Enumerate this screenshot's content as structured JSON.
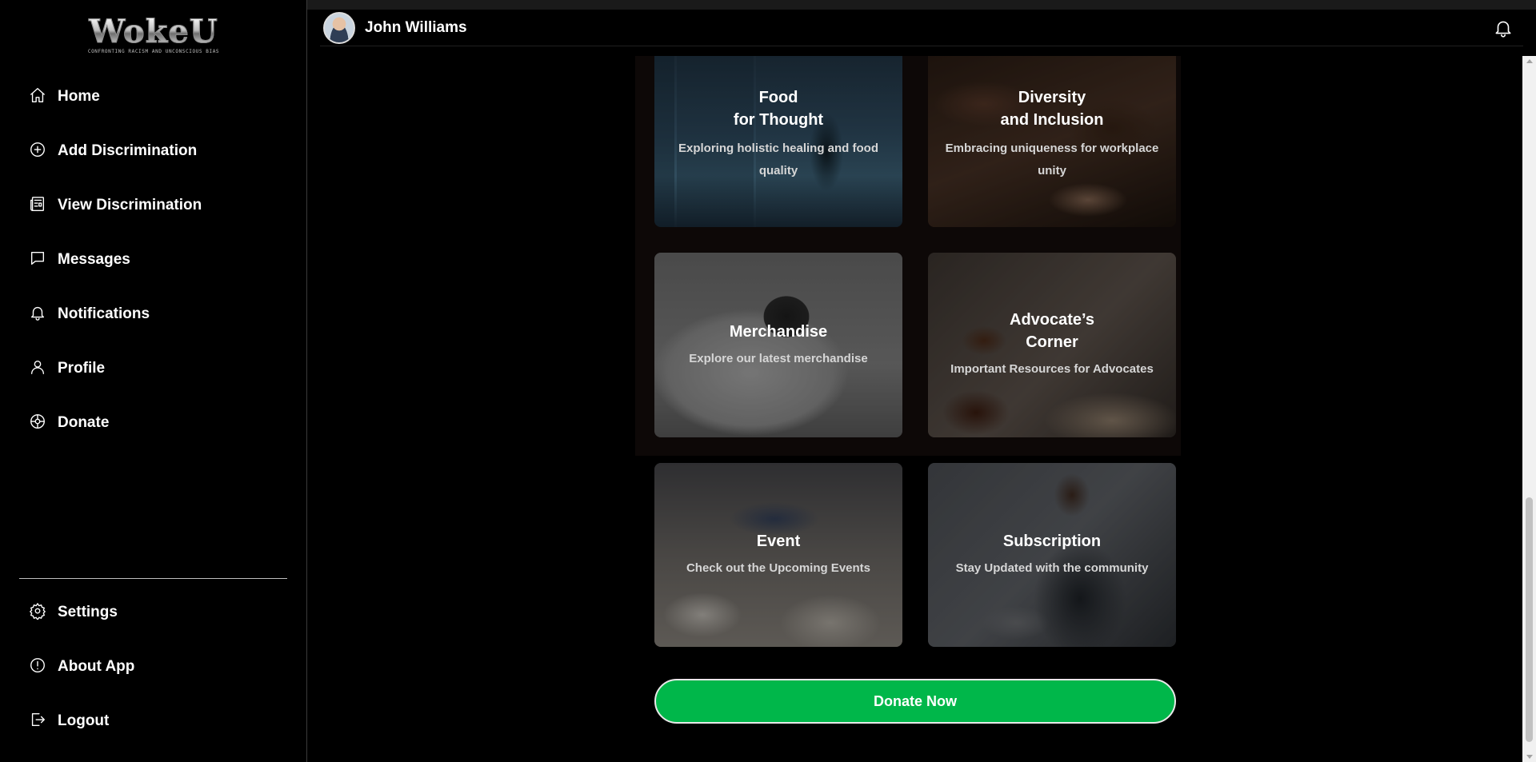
{
  "app": {
    "logo_text": "WokeU",
    "logo_tagline": "CONFRONTING RACISM AND UNCONSCIOUS BIAS"
  },
  "sidebar": {
    "items": [
      {
        "label": "Home",
        "icon": "home-icon"
      },
      {
        "label": "Add Discrimination",
        "icon": "plus-circle-icon"
      },
      {
        "label": "View Discrimination",
        "icon": "newspaper-icon"
      },
      {
        "label": "Messages",
        "icon": "message-icon"
      },
      {
        "label": "Notifications",
        "icon": "bell-icon"
      },
      {
        "label": "Profile",
        "icon": "user-icon"
      },
      {
        "label": "Donate",
        "icon": "donate-icon"
      }
    ],
    "bottom_items": [
      {
        "label": "Settings",
        "icon": "gear-icon"
      },
      {
        "label": "About App",
        "icon": "info-icon"
      },
      {
        "label": "Logout",
        "icon": "logout-icon"
      }
    ]
  },
  "header": {
    "user_name": "John Williams",
    "notification_icon": "bell-icon"
  },
  "cards": [
    {
      "title": "Food\nfor Thought",
      "subtitle": "Exploring holistic healing and food quality"
    },
    {
      "title": "Diversity\nand Inclusion",
      "subtitle": "Embracing uniqueness for workplace unity"
    },
    {
      "title": "Merchandise",
      "subtitle": "Explore our latest merchandise"
    },
    {
      "title": "Advocate’s\nCorner",
      "subtitle": "Important Resources for Advocates"
    },
    {
      "title": "Event",
      "subtitle": "Check out the Upcoming Events"
    },
    {
      "title": "Subscription",
      "subtitle": "Stay Updated with the community"
    }
  ],
  "donate_button": {
    "label": "Donate Now"
  },
  "colors": {
    "accent": "#00b74a",
    "background": "#000000",
    "text": "#ffffff"
  }
}
